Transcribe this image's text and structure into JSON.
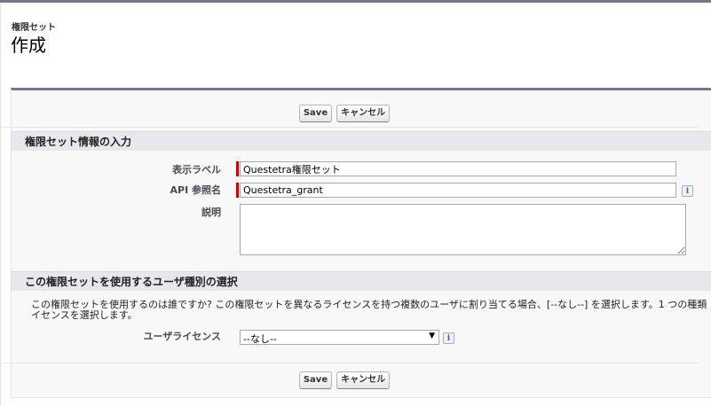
{
  "header": {
    "breadcrumb": "権限セット",
    "title": "作成"
  },
  "buttons": {
    "save": "Save",
    "cancel": "キャンセル"
  },
  "section1": {
    "title": "権限セット情報の入力",
    "fields": {
      "label": {
        "label": "表示ラベル",
        "value": "Questetra権限セット"
      },
      "api_name": {
        "label": "API 参照名",
        "value": "Questetra_grant"
      },
      "description": {
        "label": "説明",
        "value": ""
      }
    }
  },
  "section2": {
    "title": "この権限セットを使用するユーザ種別の選択",
    "description_line1": "この権限セットを使用するのは誰ですか? この権限セットを異なるライセンスを持つ複数のユーザに割り当てる場合、[--なし--] を選択します。1 つの種類",
    "description_line2": "イセンスを選択します。",
    "license": {
      "label": "ユーザライセンス",
      "value": "--なし--"
    }
  },
  "icons": {
    "info": "i",
    "dropdown": "▼"
  }
}
